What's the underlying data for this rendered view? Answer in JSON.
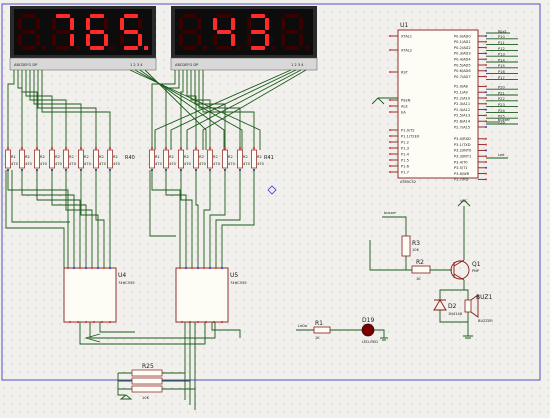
{
  "display1": {
    "digits": [
      "8",
      "7",
      "6",
      "5"
    ],
    "pins_label": "ABCDEFG  DP",
    "com_label": "1 2 3 4"
  },
  "display2": {
    "digits": [
      "8",
      "4",
      "3",
      "8"
    ],
    "pins_label": "ABCDEFG  DP",
    "com_label": "1 2 3 4"
  },
  "resistor_bank1": {
    "labels": [
      "R1",
      "R2",
      "R2",
      "R2",
      "R2",
      "R2",
      "R2",
      "R2",
      "R40"
    ],
    "value": "470"
  },
  "resistor_bank2": {
    "labels": [
      "R1",
      "R2",
      "R2",
      "R2",
      "R2",
      "R2",
      "R2",
      "R2",
      "R41"
    ],
    "value": "470"
  },
  "u4": {
    "ref": "U4",
    "part": "74HC595"
  },
  "u5": {
    "ref": "U5",
    "part": "74HC595"
  },
  "u1": {
    "ref": "U1",
    "part": "AT89C52",
    "left_pins": [
      "XTAL1",
      "XTAL2",
      "RST",
      "PSEN",
      "ALE",
      "EA",
      "P1.0/T2",
      "P1.1/T2EX",
      "P1.2",
      "P1.3",
      "P1.4",
      "P1.5",
      "P1.6",
      "P1.7"
    ],
    "right_pins": [
      "P0.0/AD0",
      "P0.1/AD1",
      "P0.2/AD2",
      "P0.3/AD3",
      "P0.4/AD4",
      "P0.5/AD5",
      "P0.6/AD6",
      "P0.7/AD7",
      "P2.0/A8",
      "P2.1/A9",
      "P2.2/A10",
      "P2.3/A11",
      "P2.4/A12",
      "P2.5/A13",
      "P2.6/A14",
      "P2.7/A15",
      "P3.0/RXD",
      "P3.1/TXD",
      "P3.2/INT0",
      "P3.3/INT1",
      "P3.4/T0",
      "P3.5/T1",
      "P3.6/WR",
      "P3.7/RD"
    ],
    "net_labels": [
      "Keys",
      "P10",
      "P11",
      "P12",
      "P13",
      "P14",
      "P15",
      "P16",
      "P17",
      "P20",
      "P21",
      "P22",
      "P23",
      "P24",
      "P25",
      "P26"
    ],
    "buzzer_label": "buzzer",
    "led_label": "Led"
  },
  "buzzer_circuit": {
    "vcc": "VCC",
    "buzzer_net": "buzzer",
    "r3": "R3",
    "r3_val": "10K",
    "r2": "R2",
    "r2_val": "1K",
    "q1": "Q1",
    "q1_type": "PNP",
    "d2": "D2",
    "d2_type": "1N4148",
    "buz": "BUZ1",
    "buz_type": "BUZZER"
  },
  "led_circuit": {
    "net": "LeDa",
    "r1": "R1",
    "r1_val": "1K",
    "d19": "D19",
    "d19_type": "LED-RED"
  },
  "r25": {
    "ref": "R25",
    "labels": [
      "R25",
      "R26",
      "R27"
    ],
    "value": "10K"
  },
  "colors": {
    "background": "#f1f0ec",
    "wire": "#1a5a1a",
    "component": "#8a1818",
    "segment_on": "#ff2a2a",
    "frame": "#4040c0"
  }
}
